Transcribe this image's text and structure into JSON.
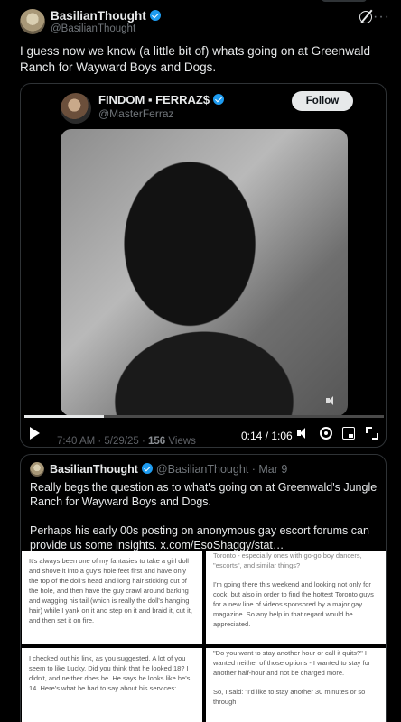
{
  "post": {
    "author_name": "BasilianThought",
    "author_handle": "@BasilianThought",
    "text": "I guess now we know (a little bit of) whats going on at Greenwald Ranch for Wayward Boys and Dogs."
  },
  "video": {
    "embed_name": "FINDOM ▪ FERRAZ$",
    "embed_handle": "@MasterFerraz",
    "follow_label": "Follow",
    "progress": 0.22,
    "timestamp": "7:40 AM · 5/29/25 · ",
    "views_count": "156",
    "views_label": " Views",
    "time": "0:14 / 1:06"
  },
  "quote": {
    "author_name": "BasilianThought",
    "author_handle": "@BasilianThought · Mar 9",
    "text_1": "Really begs the question as to what's going on at Greenwald's Jungle Ranch for Wayward Boys and Dogs.",
    "text_2": "Perhaps his early 00s posting on anonymous gay escort forums can provide us some insights. ",
    "link": "x.com/EsoShaggy/stat…",
    "images": {
      "img1_text": "It's always been one of my fantasies to take a girl doll and shove it into a guy's hole feet first and have only the top of the doll's head and long hair sticking out of the hole, and then have the guy crawl around barking and wagging his tail (which is really the doll's hanging hair) while I yank on it and step on it and braid it, cut it, and then set it on fire.",
      "img2_top": "Toronto - especially ones with go-go boy dancers, \"escorts\", and similar things?",
      "img2_body": "I'm going there this weekend and looking not only for cock, but also in order to find the hottest Toronto guys for a new line of videos sponsored by a major gay magazine. So any help in that regard would be appreciated.",
      "img3_text": "I checked out his link, as you suggested. A lot of you seem to like Lucky. Did you think that he looked 18? I didn't, and neither does he. He says he looks like he's 14. Here's what he had to say about his services:",
      "img4_top": "\"Do you want to stay another hour or call it quits?\" I wanted neither of those options - I wanted to stay for another half-hour and not be charged more.",
      "img4_bottom": "So, I said: \"I'd like to stay another 30 minutes or so through"
    }
  }
}
